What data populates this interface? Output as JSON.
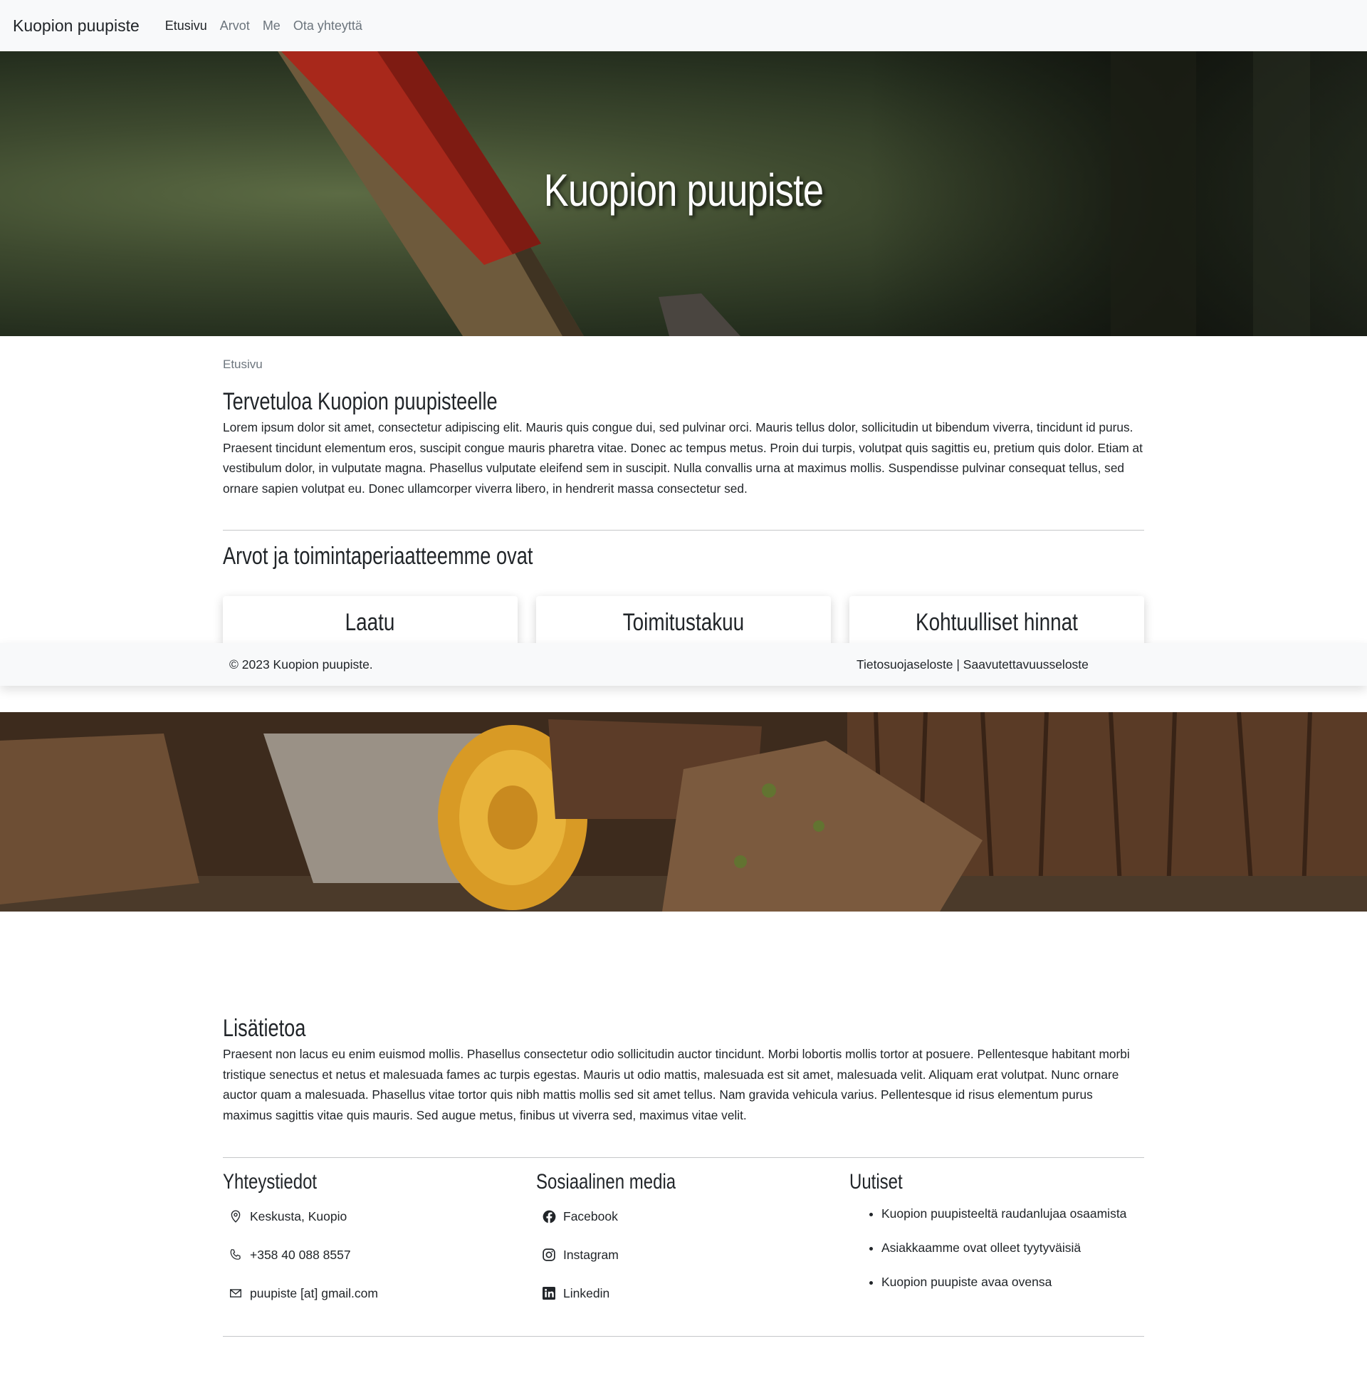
{
  "navbar": {
    "brand": "Kuopion puupiste",
    "links": [
      "Etusivu",
      "Arvot",
      "Me",
      "Ota yhteyttä"
    ]
  },
  "hero": {
    "title": "Kuopion puupiste"
  },
  "breadcrumb": "Etusivu",
  "welcome": {
    "heading": "Tervetuloa Kuopion puupisteelle",
    "text": "Lorem ipsum dolor sit amet, consectetur adipiscing elit. Mauris quis congue dui, sed pulvinar orci. Mauris tellus dolor, sollicitudin ut bibendum viverra, tincidunt id purus. Praesent tincidunt elementum eros, suscipit congue mauris pharetra vitae. Donec ac tempus metus. Proin dui turpis, volutpat quis sagittis eu, pretium quis dolor. Etiam at vestibulum dolor, in vulputate magna. Phasellus vulputate eleifend sem in suscipit. Nulla convallis urna at maximus mollis. Suspendisse pulvinar consequat tellus, sed ornare sapien volutpat eu. Donec ullamcorper viverra libero, in hendrerit massa consectetur sed."
  },
  "values": {
    "heading": "Arvot ja toimintaperiaatteemme ovat",
    "cards": [
      "Laatu",
      "Toimitustakuu",
      "Kohtuulliset hinnat"
    ]
  },
  "footer": {
    "copyright": "© 2023 Kuopion puupiste.",
    "links": "Tietosuojaseloste | Saavutettavuusseloste"
  },
  "more": {
    "heading": "Lisätietoa",
    "text": "Praesent non lacus eu enim euismod mollis. Phasellus consectetur odio sollicitudin auctor tincidunt. Morbi lobortis mollis tortor at posuere. Pellentesque habitant morbi tristique senectus et netus et malesuada fames ac turpis egestas. Mauris ut odio mattis, malesuada est sit amet, malesuada velit. Aliquam erat volutpat. Nunc ornare auctor quam a malesuada. Phasellus vitae tortor quis nibh mattis mollis sed sit amet tellus. Nam gravida vehicula varius. Pellentesque id risus elementum purus maximus sagittis vitae quis mauris. Sed augue metus, finibus ut viverra sed, maximus vitae velit."
  },
  "contact": {
    "heading": "Yhteystiedot",
    "items": [
      {
        "icon": "map-pin-icon",
        "label": "Keskusta, Kuopio"
      },
      {
        "icon": "phone-icon",
        "label": "+358 40 088 8557"
      },
      {
        "icon": "envelope-icon",
        "label": "puupiste [at] gmail.com"
      }
    ]
  },
  "social": {
    "heading": "Sosiaalinen media",
    "items": [
      {
        "icon": "facebook-icon",
        "label": "Facebook"
      },
      {
        "icon": "instagram-icon",
        "label": "Instagram"
      },
      {
        "icon": "linkedin-icon",
        "label": "Linkedin"
      }
    ]
  },
  "news": {
    "heading": "Uutiset",
    "items": [
      "Kuopion puupisteeltä raudanlujaa osaamista",
      "Asiakkaamme ovat olleet tyytyväisiä",
      "Kuopion puupiste avaa ovensa"
    ]
  }
}
